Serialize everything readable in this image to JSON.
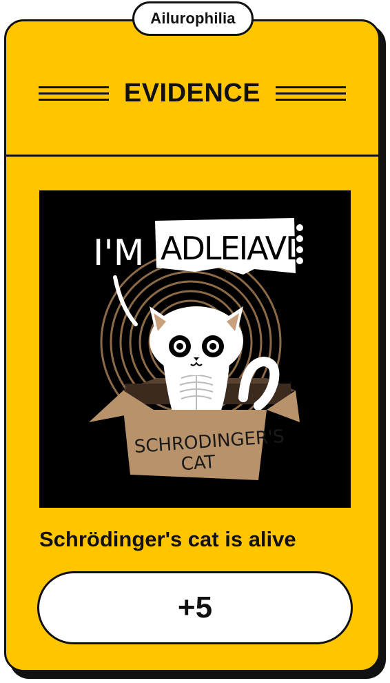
{
  "tag": {
    "label": "Ailurophilia"
  },
  "header": {
    "title": "EVIDENCE"
  },
  "illustration": {
    "speech_text": "I'M",
    "sign_text": "ADLEIAVDE",
    "box_line1": "SCHRODINGER'S",
    "box_line2": "CAT"
  },
  "caption": {
    "text": "Schrödinger's cat is alive"
  },
  "score": {
    "label": "+5"
  },
  "colors": {
    "card": "#FFC600",
    "ink": "#111111",
    "box": "#B8926A",
    "rings": "#8C6A48"
  }
}
